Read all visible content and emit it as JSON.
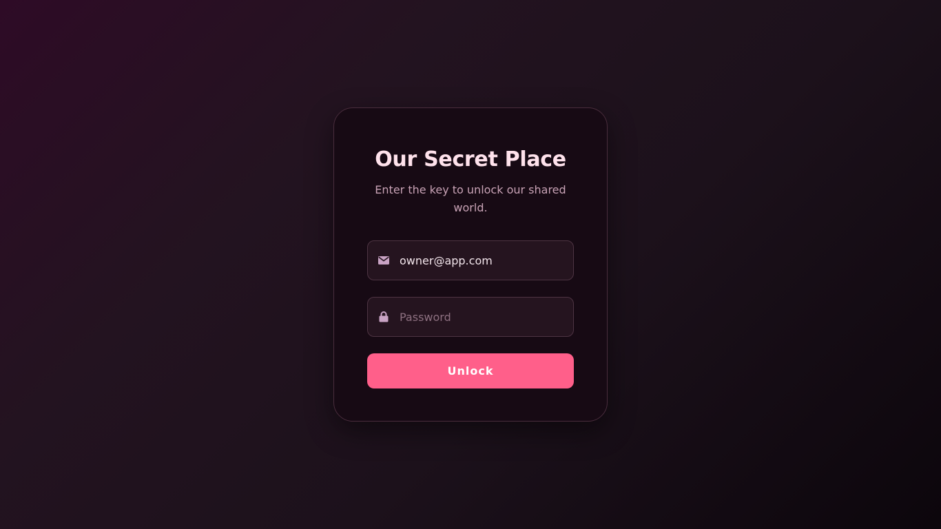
{
  "login": {
    "title": "Our Secret Place",
    "subtitle": "Enter the key to unlock our shared world.",
    "email": {
      "value": "owner@app.com",
      "icon": "envelope-icon"
    },
    "password": {
      "value": "",
      "placeholder": "Password",
      "icon": "lock-icon"
    },
    "submit_label": "Unlock"
  },
  "colors": {
    "accent": "#ff5f8a",
    "title": "#ffe2ec",
    "card_background": "#170a14",
    "input_background": "#25141f",
    "icon": "#c9a3c4"
  }
}
